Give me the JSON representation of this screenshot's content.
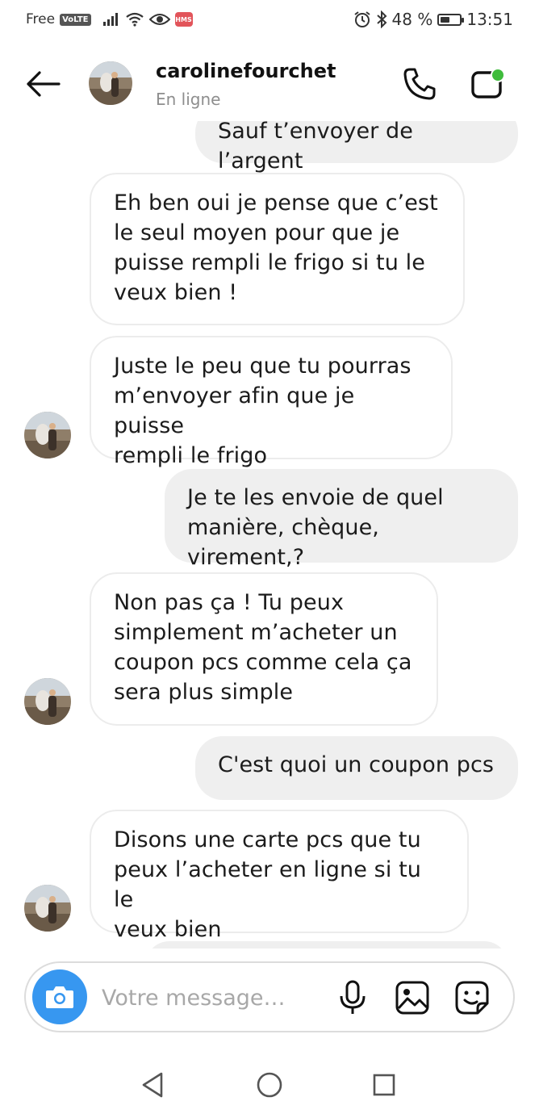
{
  "status_bar": {
    "carrier": "Free",
    "volte": "VoLTE",
    "hms_badge": "HMS",
    "battery_percent": "48 %",
    "battery_level": 0.48,
    "time": "13:51"
  },
  "header": {
    "contact_name": "carolinefourchet",
    "status": "En ligne",
    "online_indicator_color": "#3fbc3c"
  },
  "messages": [
    {
      "from": "me",
      "text": "Sauf t’envoyer de l’argent"
    },
    {
      "from": "them",
      "text": "Eh ben oui je pense que c’est\nle seul moyen pour que je\npuisse rempli le frigo si tu le\nveux bien !"
    },
    {
      "from": "them",
      "text": "Juste le peu que tu pourras\nm’envoyer afin que je puisse\nrempli le frigo"
    },
    {
      "from": "me",
      "text": "Je te les envoie de quel\nmanière, chèque, virement,?"
    },
    {
      "from": "them",
      "text": "Non pas ça ! Tu peux\nsimplement m’acheter un\ncoupon pcs comme cela ça\nsera plus simple"
    },
    {
      "from": "me",
      "text": "C'est quoi un coupon pcs"
    },
    {
      "from": "them",
      "text": "Disons une carte pcs que tu\npeux l’acheter en ligne si tu le\nveux bien"
    }
  ],
  "composer": {
    "placeholder": "Votre message…",
    "camera_button_color": "#3797f0"
  },
  "icons": {
    "back": "arrow-left-icon",
    "call": "phone-icon",
    "video": "video-camera-icon",
    "camera": "camera-icon",
    "mic": "microphone-icon",
    "gallery": "image-icon",
    "sticker": "sticker-icon",
    "nav_back": "triangle-back-icon",
    "nav_home": "circle-home-icon",
    "nav_recents": "square-recents-icon"
  }
}
